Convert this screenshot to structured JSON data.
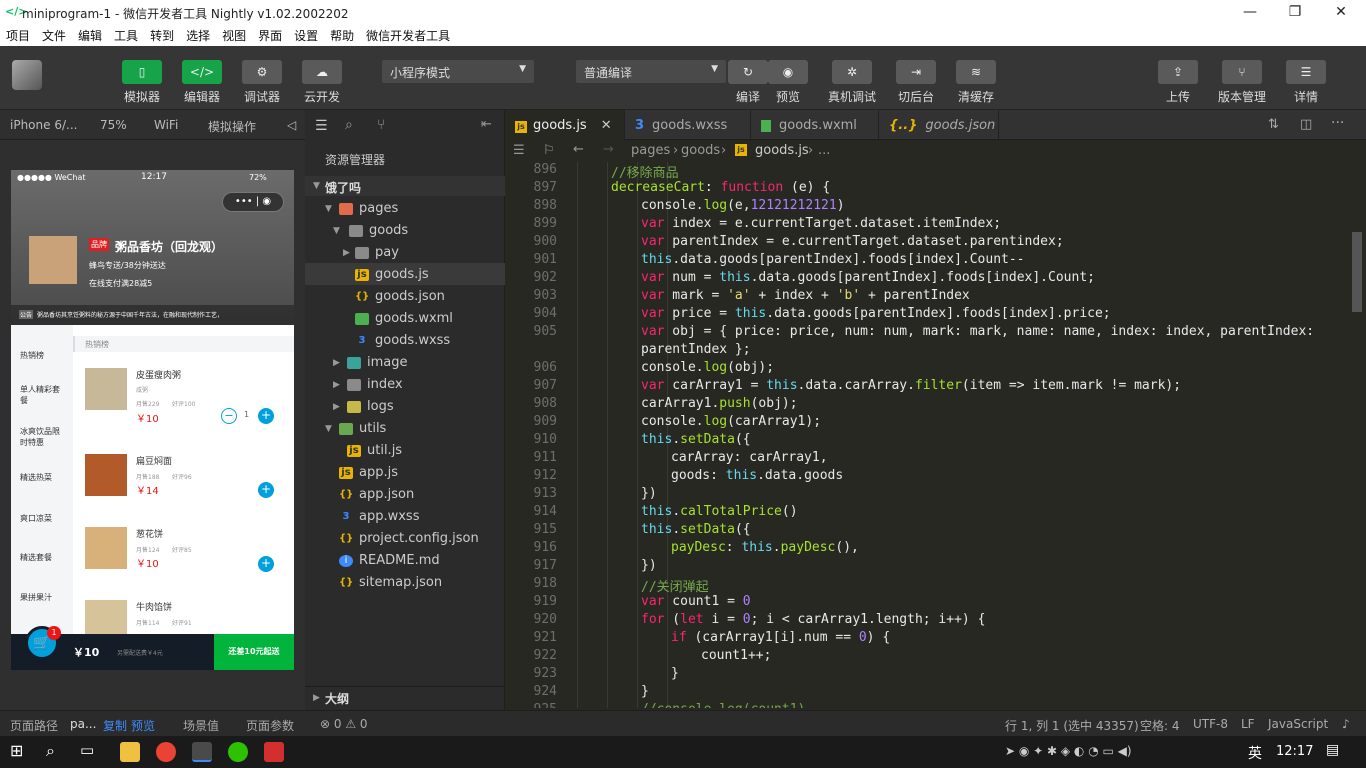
{
  "window": {
    "title": "miniprogram-1 - 微信开发者工具 Nightly v1.02.2002202"
  },
  "menu": [
    "项目",
    "文件",
    "编辑",
    "工具",
    "转到",
    "选择",
    "视图",
    "界面",
    "设置",
    "帮助",
    "微信开发者工具"
  ],
  "toolbar": {
    "simulator": "模拟器",
    "editor": "编辑器",
    "debugger": "调试器",
    "cloud": "云开发",
    "mode": "小程序模式",
    "compile_mode": "普通编译",
    "compile": "编译",
    "preview": "预览",
    "real_debug": "真机调试",
    "background": "切后台",
    "clear_cache": "清缓存",
    "upload": "上传",
    "version": "版本管理",
    "details": "详情"
  },
  "simbar": {
    "device": "iPhone 6/...",
    "zoom": "75%",
    "network": "WiFi",
    "ops": "模拟操作"
  },
  "phone": {
    "status_left": "●●●●● WeChat",
    "time": "12:17",
    "battery": "72%",
    "brand_badge": "品牌",
    "shop_name": "粥品香坊（回龙观）",
    "delivery": "蜂鸟专送/38分钟送达",
    "promo": "在线支付满28减5",
    "notice_tag": "公告",
    "notice": "粥品香坊其烹饪粥料的秘方源于中国千年古法，在融和现代制作工艺，",
    "menu": [
      "热销榜",
      "单人精彩套餐",
      "冰爽饮品限时特惠",
      "精选热菜",
      "爽口凉菜",
      "精选套餐",
      "果拼果汁"
    ],
    "section": "热销榜",
    "foods": [
      {
        "name": "皮蛋瘦肉粥",
        "desc": "咸粥",
        "sales": "月售229",
        "rating": "好评100",
        "price": "￥10",
        "count": "1"
      },
      {
        "name": "扁豆焖面",
        "desc": "",
        "sales": "月售188",
        "rating": "好评96",
        "price": "￥14"
      },
      {
        "name": "葱花饼",
        "desc": "",
        "sales": "月售124",
        "rating": "好评85",
        "price": "￥10"
      },
      {
        "name": "牛肉馅饼",
        "desc": "",
        "sales": "月售114",
        "rating": "好评91",
        "price": "￥14"
      }
    ],
    "cart_badge": "1",
    "cart_total": "￥10",
    "cart_fee": "另需配送费￥4元",
    "cart_btn": "还差10元起送"
  },
  "explorer": {
    "title": "资源管理器",
    "project": "饿了吗",
    "outline": "大纲",
    "items": [
      {
        "label": "pages",
        "type": "folder"
      },
      {
        "label": "goods",
        "type": "folder"
      },
      {
        "label": "pay",
        "type": "folder"
      },
      {
        "label": "goods.js",
        "type": "js"
      },
      {
        "label": "goods.json",
        "type": "json"
      },
      {
        "label": "goods.wxml",
        "type": "wxml"
      },
      {
        "label": "goods.wxss",
        "type": "wxss"
      },
      {
        "label": "image",
        "type": "folder"
      },
      {
        "label": "index",
        "type": "folder"
      },
      {
        "label": "logs",
        "type": "folder"
      },
      {
        "label": "utils",
        "type": "folder"
      },
      {
        "label": "util.js",
        "type": "js"
      },
      {
        "label": "app.js",
        "type": "js"
      },
      {
        "label": "app.json",
        "type": "json"
      },
      {
        "label": "app.wxss",
        "type": "wxss"
      },
      {
        "label": "project.config.json",
        "type": "json"
      },
      {
        "label": "README.md",
        "type": "info"
      },
      {
        "label": "sitemap.json",
        "type": "json"
      }
    ]
  },
  "tabs": [
    "goods.js",
    "goods.wxss",
    "goods.wxml",
    "goods.json"
  ],
  "breadcrumb": {
    "p1": "pages",
    "p2": "goods",
    "p3": "goods.js",
    "p4": "..."
  },
  "code": [
    {
      "n": "896",
      "t": "//移除商品"
    },
    {
      "n": "897",
      "t": "decreaseCart: function (e) {"
    },
    {
      "n": "898",
      "t": "console.log(e,12121212121)"
    },
    {
      "n": "899",
      "t": "var index = e.currentTarget.dataset.itemIndex;"
    },
    {
      "n": "900",
      "t": "var parentIndex = e.currentTarget.dataset.parentindex;"
    },
    {
      "n": "901",
      "t": "this.data.goods[parentIndex].foods[index].Count--"
    },
    {
      "n": "902",
      "t": "var num = this.data.goods[parentIndex].foods[index].Count;"
    },
    {
      "n": "903",
      "t": "var mark = 'a' + index + 'b' + parentIndex"
    },
    {
      "n": "904",
      "t": "var price = this.data.goods[parentIndex].foods[index].price;"
    },
    {
      "n": "905",
      "t": "var obj = { price: price, num: num, mark: mark, name: name, index: index, parentIndex:"
    },
    {
      "n": "",
      "t": "parentIndex };"
    },
    {
      "n": "906",
      "t": "console.log(obj);"
    },
    {
      "n": "907",
      "t": "var carArray1 = this.data.carArray.filter(item => item.mark != mark);"
    },
    {
      "n": "908",
      "t": "carArray1.push(obj);"
    },
    {
      "n": "909",
      "t": "console.log(carArray1);"
    },
    {
      "n": "910",
      "t": "this.setData({"
    },
    {
      "n": "911",
      "t": "carArray: carArray1,"
    },
    {
      "n": "912",
      "t": "goods: this.data.goods"
    },
    {
      "n": "913",
      "t": "})"
    },
    {
      "n": "914",
      "t": "this.calTotalPrice()"
    },
    {
      "n": "915",
      "t": "this.setData({"
    },
    {
      "n": "916",
      "t": "payDesc: this.payDesc(),"
    },
    {
      "n": "917",
      "t": "})"
    },
    {
      "n": "918",
      "t": "//关闭弹起"
    },
    {
      "n": "919",
      "t": "var count1 = 0"
    },
    {
      "n": "920",
      "t": "for (let i = 0; i < carArray1.length; i++) {"
    },
    {
      "n": "921",
      "t": "if (carArray1[i].num == 0) {"
    },
    {
      "n": "922",
      "t": "count1++;"
    },
    {
      "n": "923",
      "t": "}"
    },
    {
      "n": "924",
      "t": "}"
    },
    {
      "n": "925",
      "t": "//console.log(count1)"
    }
  ],
  "status": {
    "page_path": "页面路径",
    "path_short": "pa...",
    "copy": "复制",
    "preview": "预览",
    "scene": "场景值",
    "params": "页面参数",
    "errors": "⊗ 0 ⚠ 0",
    "cursor": "行 1, 列 1 (选中 43357)",
    "spaces": "空格: 4",
    "encoding": "UTF-8",
    "eol": "LF",
    "lang": "JavaScript"
  },
  "taskbar": {
    "ime": "英",
    "time": "12:17"
  }
}
